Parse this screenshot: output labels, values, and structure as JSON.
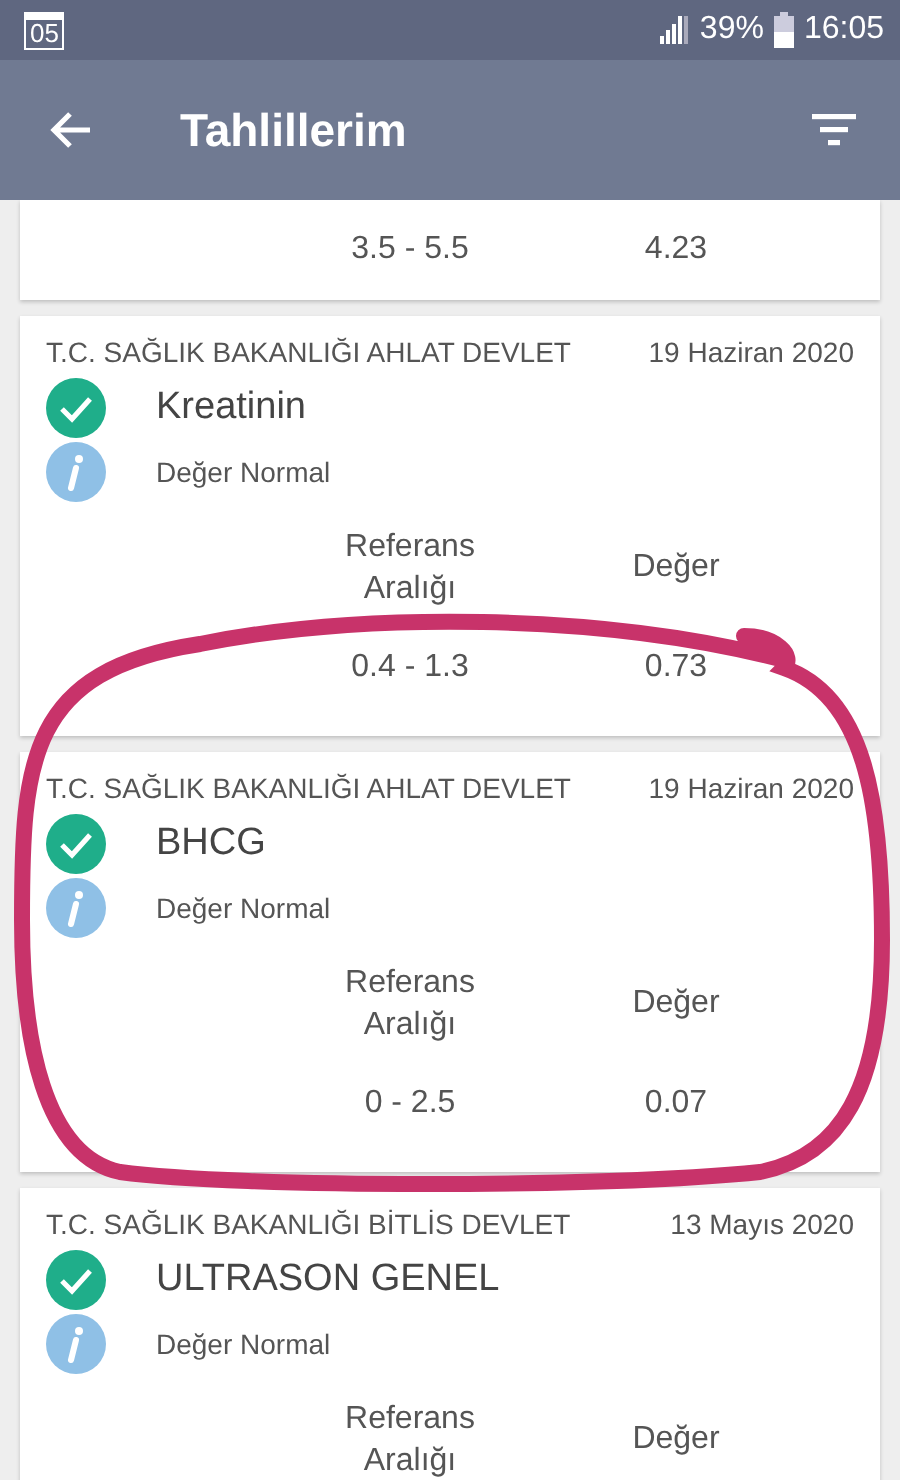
{
  "status_bar": {
    "notification": "05",
    "battery": "39%",
    "time": "16:05"
  },
  "app_bar": {
    "title": "Tahlillerim"
  },
  "results": [
    {
      "kind": "partial",
      "reference_range": "3.5 - 5.5",
      "value": "4.23"
    },
    {
      "kind": "full",
      "hospital": "T.C. SAĞLIK BAKANLIĞI AHLAT DEVLET",
      "date": "19 Haziran 2020",
      "test": "Kreatinin",
      "status": "Değer Normal",
      "range_label": "Referans Aralığı",
      "value_label": "Değer",
      "reference_range": "0.4 - 1.3",
      "value": "0.73"
    },
    {
      "kind": "full",
      "hospital": "T.C. SAĞLIK BAKANLIĞI AHLAT DEVLET",
      "date": "19 Haziran 2020",
      "test": "BHCG",
      "status": "Değer Normal",
      "range_label": "Referans Aralığı",
      "value_label": "Değer",
      "reference_range": "0 - 2.5",
      "value": "0.07"
    },
    {
      "kind": "full",
      "hospital": "T.C. SAĞLIK BAKANLIĞI BİTLİS DEVLET",
      "date": "13 Mayıs 2020",
      "test": "ULTRASON GENEL",
      "status": "Değer Normal",
      "range_label": "Referans Aralığı",
      "value_label": "Değer"
    }
  ],
  "annotation": {
    "kind": "circle"
  }
}
